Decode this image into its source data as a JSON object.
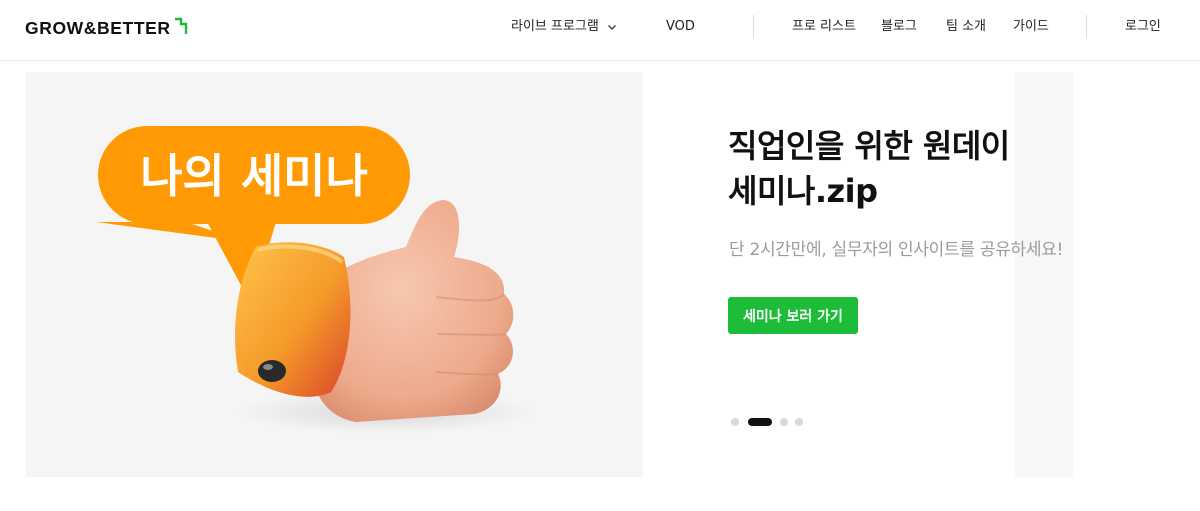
{
  "header": {
    "logo_text": "GROW&BETTER",
    "nav": {
      "live_program": "라이브 프로그램",
      "vod": "VOD",
      "pro_list": "프로 리스트",
      "blog": "블로그",
      "team": "팀 소개",
      "guide": "가이드",
      "login": "로그인"
    }
  },
  "hero": {
    "image_caption": "나의 세미나",
    "title_line1": "직업인을 위한 원데이",
    "title_line2": "세미나.zip",
    "subtitle": "단 2시간만에, 실무자의 인사이트를 공유하세요!",
    "cta_label": "세미나 보러 가기",
    "carousel": {
      "total": 4,
      "active_index": 1
    }
  },
  "colors": {
    "brand_green": "#1dbd3a",
    "bubble_orange": "#ff9a05",
    "text_dark": "#111111",
    "text_muted": "#9b9b9b"
  }
}
